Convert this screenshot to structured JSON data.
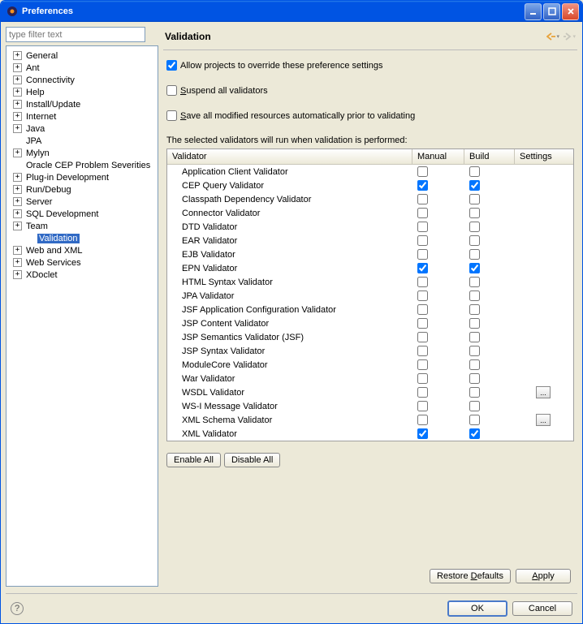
{
  "window": {
    "title": "Preferences"
  },
  "filter": {
    "placeholder": "type filter text"
  },
  "tree": [
    {
      "label": "General",
      "exp": true,
      "level": 0
    },
    {
      "label": "Ant",
      "exp": true,
      "level": 0
    },
    {
      "label": "Connectivity",
      "exp": true,
      "level": 0
    },
    {
      "label": "Help",
      "exp": true,
      "level": 0
    },
    {
      "label": "Install/Update",
      "exp": true,
      "level": 0
    },
    {
      "label": "Internet",
      "exp": true,
      "level": 0
    },
    {
      "label": "Java",
      "exp": true,
      "level": 0
    },
    {
      "label": "JPA",
      "exp": false,
      "level": 0
    },
    {
      "label": "Mylyn",
      "exp": true,
      "level": 0
    },
    {
      "label": "Oracle CEP Problem Severities",
      "exp": false,
      "level": 0
    },
    {
      "label": "Plug-in Development",
      "exp": true,
      "level": 0
    },
    {
      "label": "Run/Debug",
      "exp": true,
      "level": 0
    },
    {
      "label": "Server",
      "exp": true,
      "level": 0
    },
    {
      "label": "SQL Development",
      "exp": true,
      "level": 0
    },
    {
      "label": "Team",
      "exp": true,
      "level": 0
    },
    {
      "label": "Validation",
      "exp": false,
      "level": 1,
      "selected": true
    },
    {
      "label": "Web and XML",
      "exp": true,
      "level": 0
    },
    {
      "label": "Web Services",
      "exp": true,
      "level": 0
    },
    {
      "label": "XDoclet",
      "exp": true,
      "level": 0
    }
  ],
  "page": {
    "title": "Validation",
    "allow_override": {
      "checked": true,
      "label": "Allow projects to override these preference settings"
    },
    "suspend": {
      "checked": false,
      "label": "Suspend all validators"
    },
    "save_all": {
      "checked": false,
      "label": "Save all modified resources automatically prior to validating"
    },
    "desc": "The selected validators will run when validation is performed:",
    "cols": {
      "validator": "Validator",
      "manual": "Manual",
      "build": "Build",
      "settings": "Settings"
    },
    "rows": [
      {
        "name": "Application Client Validator",
        "manual": false,
        "build": false,
        "settings": false
      },
      {
        "name": "CEP Query Validator",
        "manual": true,
        "build": true,
        "settings": false
      },
      {
        "name": "Classpath Dependency Validator",
        "manual": false,
        "build": false,
        "settings": false
      },
      {
        "name": "Connector Validator",
        "manual": false,
        "build": false,
        "settings": false
      },
      {
        "name": "DTD Validator",
        "manual": false,
        "build": false,
        "settings": false
      },
      {
        "name": "EAR Validator",
        "manual": false,
        "build": false,
        "settings": false
      },
      {
        "name": "EJB Validator",
        "manual": false,
        "build": false,
        "settings": false
      },
      {
        "name": "EPN Validator",
        "manual": true,
        "build": true,
        "settings": false
      },
      {
        "name": "HTML Syntax Validator",
        "manual": false,
        "build": false,
        "settings": false
      },
      {
        "name": "JPA Validator",
        "manual": false,
        "build": false,
        "settings": false
      },
      {
        "name": "JSF Application Configuration Validator",
        "manual": false,
        "build": false,
        "settings": false
      },
      {
        "name": "JSP Content Validator",
        "manual": false,
        "build": false,
        "settings": false
      },
      {
        "name": "JSP Semantics Validator (JSF)",
        "manual": false,
        "build": false,
        "settings": false
      },
      {
        "name": "JSP Syntax Validator",
        "manual": false,
        "build": false,
        "settings": false
      },
      {
        "name": "ModuleCore Validator",
        "manual": false,
        "build": false,
        "settings": false
      },
      {
        "name": "War Validator",
        "manual": false,
        "build": false,
        "settings": false
      },
      {
        "name": "WSDL Validator",
        "manual": false,
        "build": false,
        "settings": true
      },
      {
        "name": "WS-I Message Validator",
        "manual": false,
        "build": false,
        "settings": false
      },
      {
        "name": "XML Schema Validator",
        "manual": false,
        "build": false,
        "settings": true
      },
      {
        "name": "XML Validator",
        "manual": true,
        "build": true,
        "settings": false
      }
    ],
    "enable_all": "Enable All",
    "disable_all": "Disable All",
    "restore": "Restore Defaults",
    "apply": "Apply"
  },
  "dialog": {
    "ok": "OK",
    "cancel": "Cancel"
  }
}
